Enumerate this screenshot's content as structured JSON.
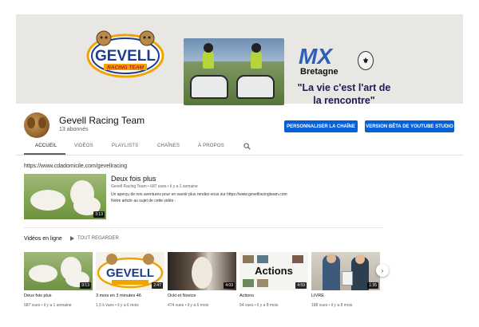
{
  "banner": {
    "logo_text": "GEVELL",
    "logo_sub": "RACING TEAM",
    "mx_text": "MX",
    "mx_sub": "Bretagne",
    "tagline_line1": "\"La vie c'est l'art de",
    "tagline_line2": "la rencontre\""
  },
  "channel": {
    "name": "Gevell Racing Team",
    "subscribers": "13 abonnés",
    "customize_label": "PERSONNALISER LA CHAÎNE",
    "studio_label": "VERSION BÊTA DE YOUTUBE STUDIO"
  },
  "tabs": [
    {
      "label": "ACCUEIL",
      "active": true
    },
    {
      "label": "VIDÉOS",
      "active": false
    },
    {
      "label": "PLAYLISTS",
      "active": false
    },
    {
      "label": "CHAÎNES",
      "active": false
    },
    {
      "label": "À PROPOS",
      "active": false
    }
  ],
  "featured": {
    "url": "https://www.cdadomicile.com/gevellracing",
    "title": "Deux fois plus",
    "meta": "Gevell Racing Team • 687 vues • il y a 1 semaine",
    "desc_line1": "Un aperçu de nos aventures pour en savoir plus rendez-vous sur https://www.gevellracingteam.com",
    "desc_line2": "Notre article au sujet de cette vidéo :",
    "duration": "3:13"
  },
  "shelf": {
    "title": "Vidéos en ligne",
    "play_all": "TOUT REGARDER",
    "videos": [
      {
        "title": "Deux fois plus",
        "meta": "687 vues • il y a 1 semaine",
        "duration": "3:13"
      },
      {
        "title": "3 mois en 3 minutes 46",
        "meta": "1,5 k vues • il y a 6 mois",
        "duration": "2:47"
      },
      {
        "title": "Ocki et Novice",
        "meta": "474 vues • il y a 6 mois",
        "duration": "4:09"
      },
      {
        "title": "Actions",
        "meta": "54 vues • il y a 8 mois",
        "duration": "4:59",
        "thumb_text": "Actions"
      },
      {
        "title": "LIVRE",
        "meta": "188 vues • il y a 8 mois",
        "duration": "1:35"
      }
    ]
  },
  "colors": {
    "accent_blue": "#065fd4",
    "banner_bg": "#e9e7e4"
  }
}
